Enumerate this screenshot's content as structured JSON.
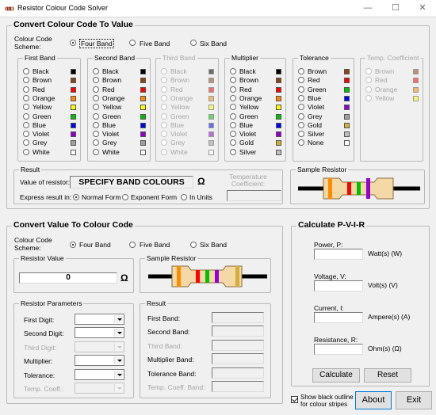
{
  "window": {
    "title": "Resistor Colour Code Solver",
    "minimize": "—",
    "maximize": "☐",
    "close": "✕"
  },
  "ctv": {
    "title": "Convert Colour Code To Value",
    "scheme_label": "Colour Code Scheme:",
    "scheme_options": [
      "Four Band",
      "Five Band",
      "Six Band"
    ],
    "scheme_selected": "Four Band",
    "bands": [
      {
        "title": "First Band",
        "enabled": true,
        "items": [
          [
            "Black",
            "#000000"
          ],
          [
            "Brown",
            "#8b4513"
          ],
          [
            "Red",
            "#ff0000"
          ],
          [
            "Orange",
            "#ff8c00"
          ],
          [
            "Yellow",
            "#ffff00"
          ],
          [
            "Green",
            "#00c000"
          ],
          [
            "Blue",
            "#0000ff"
          ],
          [
            "Violet",
            "#9400d3"
          ],
          [
            "Grey",
            "#a0a0a0"
          ],
          [
            "White",
            "#ffffff"
          ]
        ]
      },
      {
        "title": "Second Band",
        "enabled": true,
        "items": [
          [
            "Black",
            "#000000"
          ],
          [
            "Brown",
            "#8b4513"
          ],
          [
            "Red",
            "#ff0000"
          ],
          [
            "Orange",
            "#ff8c00"
          ],
          [
            "Yellow",
            "#ffff00"
          ],
          [
            "Green",
            "#00c000"
          ],
          [
            "Blue",
            "#0000ff"
          ],
          [
            "Violet",
            "#9400d3"
          ],
          [
            "Grey",
            "#a0a0a0"
          ],
          [
            "White",
            "#ffffff"
          ]
        ]
      },
      {
        "title": "Third Band",
        "enabled": false,
        "items": [
          [
            "Black",
            "#000000"
          ],
          [
            "Brown",
            "#8b4513"
          ],
          [
            "Red",
            "#ff0000"
          ],
          [
            "Orange",
            "#ff8c00"
          ],
          [
            "Yellow",
            "#ffff00"
          ],
          [
            "Green",
            "#00c000"
          ],
          [
            "Blue",
            "#0000ff"
          ],
          [
            "Violet",
            "#9400d3"
          ],
          [
            "Grey",
            "#a0a0a0"
          ],
          [
            "White",
            "#ffffff"
          ]
        ]
      },
      {
        "title": "Multiplier",
        "enabled": true,
        "items": [
          [
            "Black",
            "#000000"
          ],
          [
            "Brown",
            "#8b4513"
          ],
          [
            "Red",
            "#ff0000"
          ],
          [
            "Orange",
            "#ff8c00"
          ],
          [
            "Yellow",
            "#ffff00"
          ],
          [
            "Green",
            "#00c000"
          ],
          [
            "Blue",
            "#0000ff"
          ],
          [
            "Violet",
            "#9400d3"
          ],
          [
            "Gold",
            "#d4af37"
          ],
          [
            "Silver",
            "#c0c0c0"
          ]
        ]
      },
      {
        "title": "Tolerance",
        "enabled": true,
        "items": [
          [
            "Brown",
            "#8b4513"
          ],
          [
            "Red",
            "#ff0000"
          ],
          [
            "Green",
            "#00c000"
          ],
          [
            "Blue",
            "#0000ff"
          ],
          [
            "Violet",
            "#9400d3"
          ],
          [
            "Grey",
            "#a0a0a0"
          ],
          [
            "Gold",
            "#d4af37"
          ],
          [
            "Silver",
            "#c0c0c0"
          ],
          [
            "None",
            "#ffffff"
          ]
        ]
      },
      {
        "title": "Temp. Coefficient",
        "enabled": false,
        "items": [
          [
            "Brown",
            "#8b4513"
          ],
          [
            "Red",
            "#ff0000"
          ],
          [
            "Orange",
            "#ff8c00"
          ],
          [
            "Yellow",
            "#ffff00"
          ]
        ]
      }
    ],
    "result": {
      "title": "Result",
      "value_label": "Value of resistor:",
      "value": "SPECIFY BAND COLOURS",
      "unit": "Ω",
      "temp_label": "Temperature Coefficient:",
      "temp_value": "",
      "express_label": "Express result in:",
      "express_options": [
        "Normal Form",
        "Exponent Form",
        "In Units"
      ],
      "express_selected": "Normal Form"
    },
    "sample_title": "Sample Resistor",
    "sample_bands": [
      "#ff8c00",
      "#ff0000",
      "#00c000",
      "#9400d3"
    ]
  },
  "vtc": {
    "title": "Convert Value To Colour Code",
    "scheme_label": "Colour Code Scheme:",
    "scheme_options": [
      "Four Band",
      "Five Band",
      "Six Band"
    ],
    "scheme_selected": "Four Band",
    "value_title": "Resistor Value",
    "value": "0",
    "unit": "Ω",
    "sample_title": "Sample Resistor",
    "sample_bands": [
      "#ff8c00",
      "#ff0000",
      "#00c000",
      "#9400d3",
      "#d4af37"
    ],
    "params_title": "Resistor Parameters",
    "params": [
      {
        "label": "First Digit:",
        "enabled": true
      },
      {
        "label": "Second Digit:",
        "enabled": true
      },
      {
        "label": "Third Digit:",
        "enabled": false
      },
      {
        "label": "Multiplier:",
        "enabled": true
      },
      {
        "label": "Tolerance:",
        "enabled": true
      },
      {
        "label": "Temp. Coeff.:",
        "enabled": false
      }
    ],
    "result_title": "Result",
    "results": [
      {
        "label": "First Band:",
        "enabled": true
      },
      {
        "label": "Second Band:",
        "enabled": true
      },
      {
        "label": "Third Band:",
        "enabled": false
      },
      {
        "label": "Multiplier Band:",
        "enabled": true
      },
      {
        "label": "Tolerance Band:",
        "enabled": true
      },
      {
        "label": "Temp. Coeff. Band:",
        "enabled": false
      }
    ]
  },
  "pvir": {
    "title": "Calculate P-V-I-R",
    "fields": [
      {
        "label": "Power, P:",
        "unit": "Watt(s) (W)"
      },
      {
        "label": "Voltage, V:",
        "unit": "Volt(s) (V)"
      },
      {
        "label": "Current, I:",
        "unit": "Ampere(s) (A)"
      },
      {
        "label": "Resistance, R:",
        "unit": "Ohm(s) (Ω)"
      }
    ],
    "calculate": "Calculate",
    "reset": "Reset"
  },
  "footer": {
    "outline_label": "Show black outline for colour stripes",
    "about": "About",
    "exit": "Exit"
  }
}
